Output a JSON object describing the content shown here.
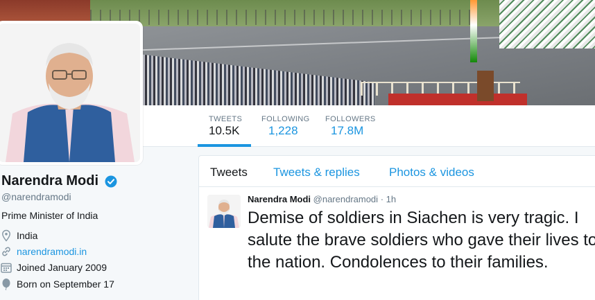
{
  "profile": {
    "name": "Narendra Modi",
    "handle": "@narendramodi",
    "bio": "Prime Minister of India",
    "location": "India",
    "website": "narendramodi.in",
    "joined": "Joined January 2009",
    "born": "Born on September 17",
    "verified_icon": "verified-badge-icon"
  },
  "stats": [
    {
      "label": "TWEETS",
      "value": "10.5K"
    },
    {
      "label": "FOLLOWING",
      "value": "1,228"
    },
    {
      "label": "FOLLOWERS",
      "value": "17.8M"
    }
  ],
  "tabs": [
    {
      "label": "Tweets"
    },
    {
      "label": "Tweets & replies"
    },
    {
      "label": "Photos & videos"
    }
  ],
  "tweet": {
    "name": "Narendra Modi",
    "handle": "@narendramodi",
    "separator": "·",
    "time": "1h",
    "text": "Demise of soldiers in Siachen is very tragic. I salute the brave soldiers who gave their lives to the nation. Condolences to their families."
  },
  "colors": {
    "accent": "#1b95e0",
    "text": "#14171a",
    "muted": "#657786",
    "background": "#f5f8fa"
  }
}
